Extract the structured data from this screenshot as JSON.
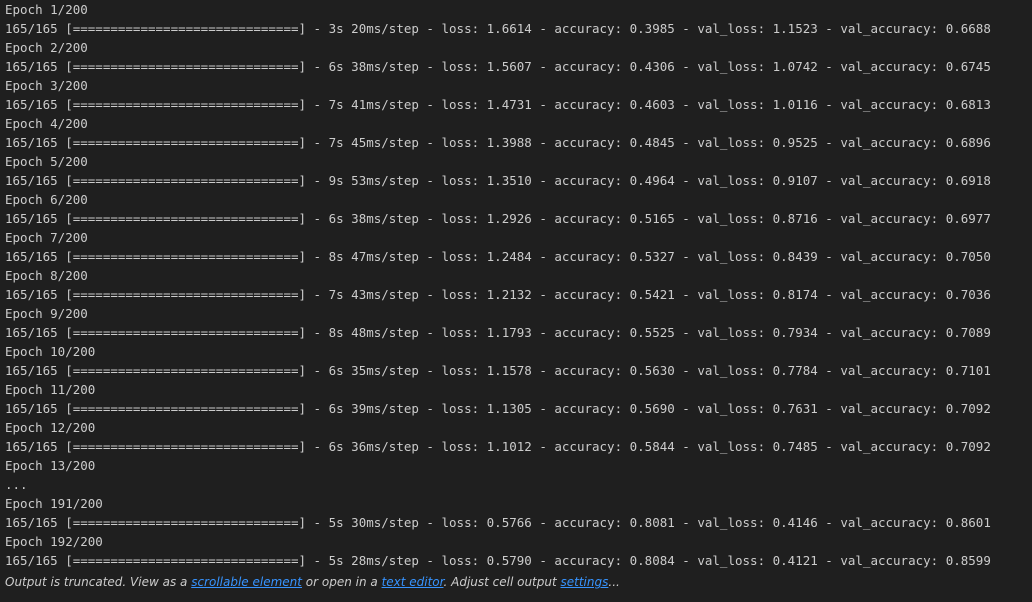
{
  "output": {
    "lines": [
      "Epoch 1/200",
      "165/165 [==============================] - 3s 20ms/step - loss: 1.6614 - accuracy: 0.3985 - val_loss: 1.1523 - val_accuracy: 0.6688",
      "Epoch 2/200",
      "165/165 [==============================] - 6s 38ms/step - loss: 1.5607 - accuracy: 0.4306 - val_loss: 1.0742 - val_accuracy: 0.6745",
      "Epoch 3/200",
      "165/165 [==============================] - 7s 41ms/step - loss: 1.4731 - accuracy: 0.4603 - val_loss: 1.0116 - val_accuracy: 0.6813",
      "Epoch 4/200",
      "165/165 [==============================] - 7s 45ms/step - loss: 1.3988 - accuracy: 0.4845 - val_loss: 0.9525 - val_accuracy: 0.6896",
      "Epoch 5/200",
      "165/165 [==============================] - 9s 53ms/step - loss: 1.3510 - accuracy: 0.4964 - val_loss: 0.9107 - val_accuracy: 0.6918",
      "Epoch 6/200",
      "165/165 [==============================] - 6s 38ms/step - loss: 1.2926 - accuracy: 0.5165 - val_loss: 0.8716 - val_accuracy: 0.6977",
      "Epoch 7/200",
      "165/165 [==============================] - 8s 47ms/step - loss: 1.2484 - accuracy: 0.5327 - val_loss: 0.8439 - val_accuracy: 0.7050",
      "Epoch 8/200",
      "165/165 [==============================] - 7s 43ms/step - loss: 1.2132 - accuracy: 0.5421 - val_loss: 0.8174 - val_accuracy: 0.7036",
      "Epoch 9/200",
      "165/165 [==============================] - 8s 48ms/step - loss: 1.1793 - accuracy: 0.5525 - val_loss: 0.7934 - val_accuracy: 0.7089",
      "Epoch 10/200",
      "165/165 [==============================] - 6s 35ms/step - loss: 1.1578 - accuracy: 0.5630 - val_loss: 0.7784 - val_accuracy: 0.7101",
      "Epoch 11/200",
      "165/165 [==============================] - 6s 39ms/step - loss: 1.1305 - accuracy: 0.5690 - val_loss: 0.7631 - val_accuracy: 0.7092",
      "Epoch 12/200",
      "165/165 [==============================] - 6s 36ms/step - loss: 1.1012 - accuracy: 0.5844 - val_loss: 0.7485 - val_accuracy: 0.7092",
      "Epoch 13/200",
      "...",
      "Epoch 191/200",
      "165/165 [==============================] - 5s 30ms/step - loss: 0.5766 - accuracy: 0.8081 - val_loss: 0.4146 - val_accuracy: 0.8601",
      "Epoch 192/200",
      "165/165 [==============================] - 5s 28ms/step - loss: 0.5790 - accuracy: 0.8084 - val_loss: 0.4121 - val_accuracy: 0.8599"
    ]
  },
  "truncation": {
    "text_1": "Output is truncated. View as a ",
    "link_scrollable": "scrollable element",
    "text_2": " or open in a ",
    "link_editor": "text editor",
    "text_3": ". Adjust cell output ",
    "link_settings": "settings",
    "text_4": "..."
  },
  "colors": {
    "background": "#1f1f1f",
    "text": "#cccccc",
    "link": "#3794ff"
  }
}
